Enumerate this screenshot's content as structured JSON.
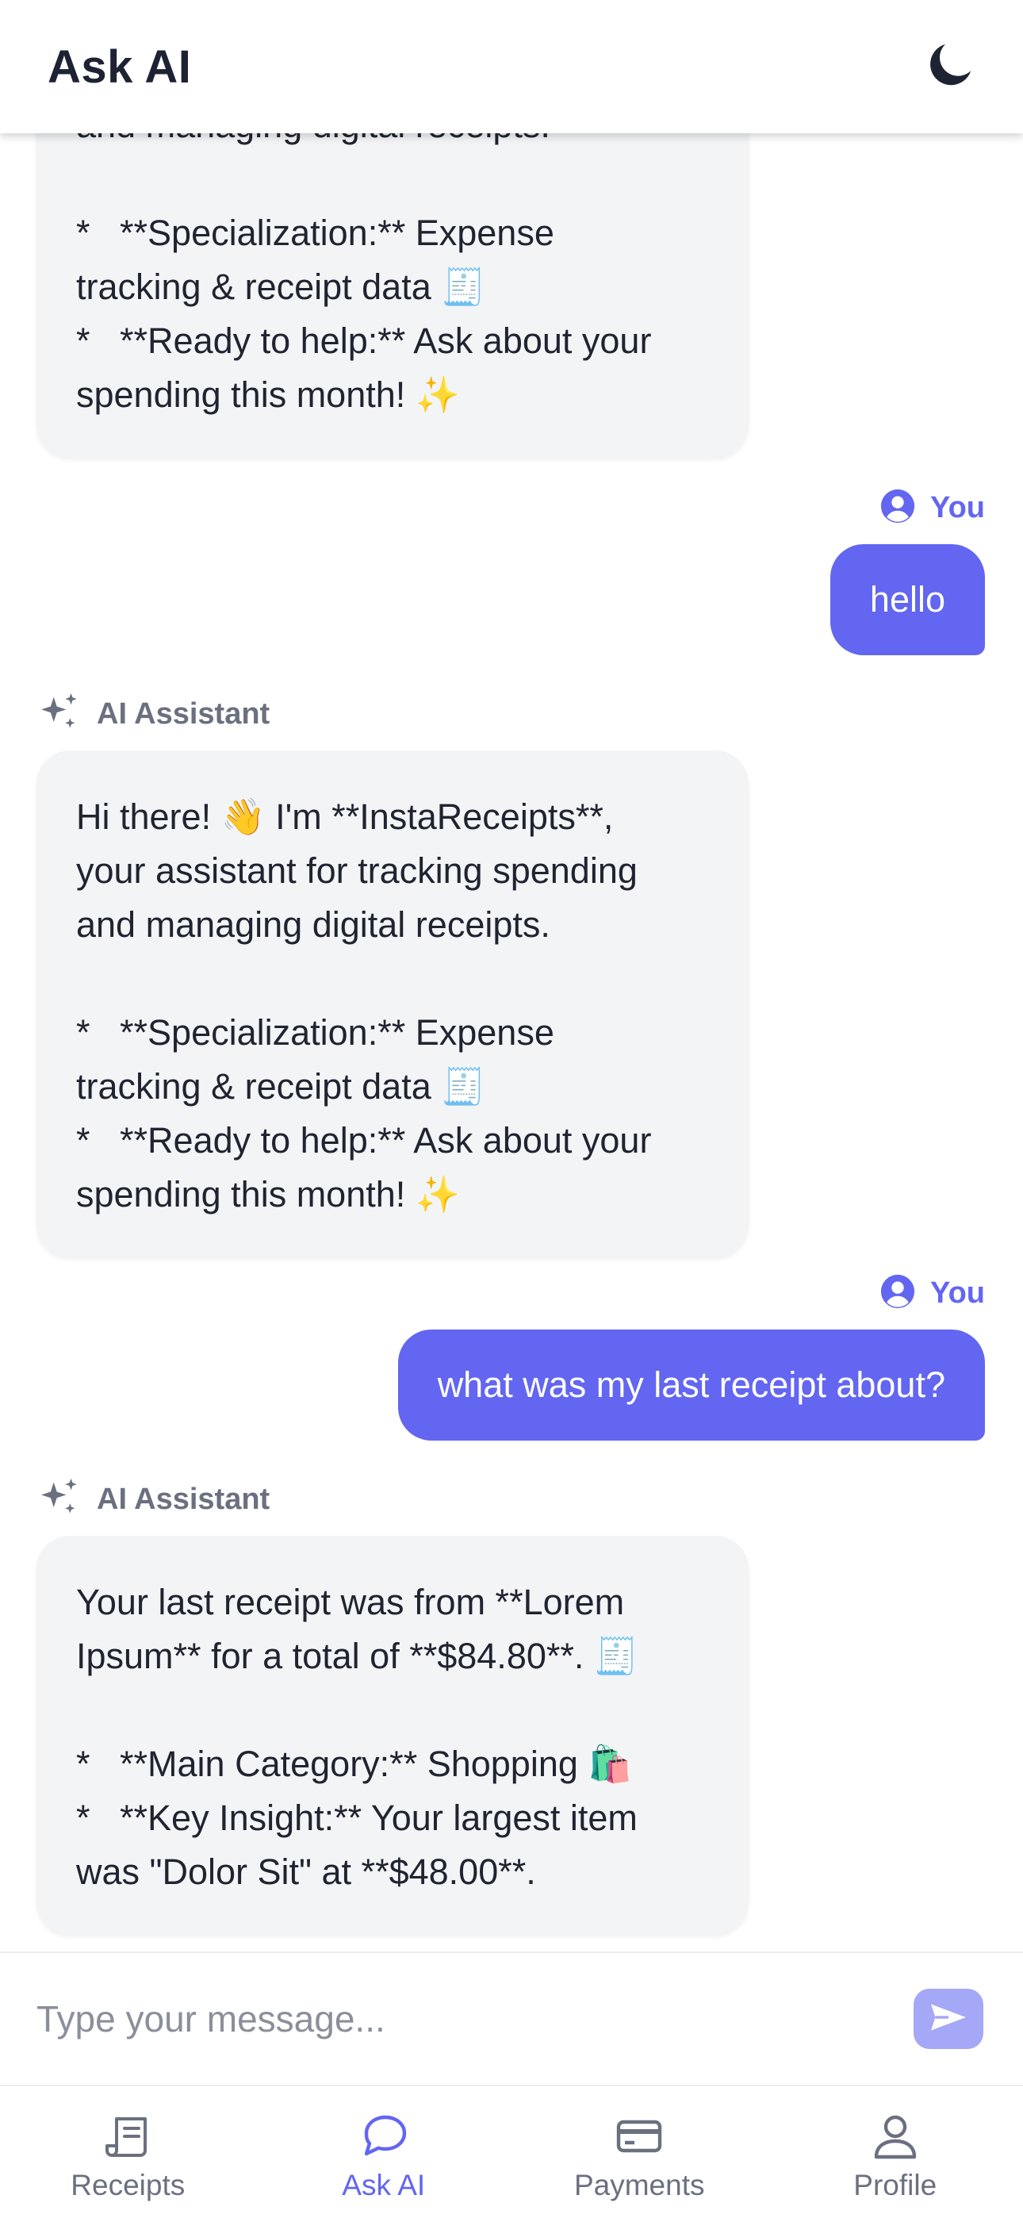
{
  "header": {
    "title": "Ask AI",
    "theme_icon": "moon-icon"
  },
  "colors": {
    "accent": "#6366f1",
    "ai_bubble": "#f3f4f6",
    "muted": "#6b7080",
    "send_button": "#a5a8f6"
  },
  "messages": [
    {
      "role": "ai",
      "lines": [
        "and managing digital receipts.",
        "",
        "*   **Specialization:** Expense",
        "tracking & receipt data 🧾",
        "*   **Ready to help:** Ask about your",
        "spending this month! ✨"
      ]
    },
    {
      "role": "user",
      "sender": "You",
      "text": "hello"
    },
    {
      "role": "ai",
      "sender": "AI Assistant",
      "lines": [
        "Hi there! 👋 I'm **InstaReceipts**,",
        "your assistant for tracking spending",
        "and managing digital receipts.",
        "",
        "*   **Specialization:** Expense",
        "tracking & receipt data 🧾",
        "*   **Ready to help:** Ask about your",
        "spending this month! ✨"
      ]
    },
    {
      "role": "user",
      "sender": "You",
      "text": "what was my last receipt about?"
    },
    {
      "role": "ai",
      "sender": "AI Assistant",
      "lines": [
        "Your last receipt was from **Lorem",
        "Ipsum** for a total of **$84.80**. 🧾",
        "",
        "*   **Main Category:** Shopping 🛍️",
        "*   **Key Insight:** Your largest item",
        "was \"Dolor Sit\" at **$48.00**."
      ]
    }
  ],
  "composer": {
    "placeholder": "Type your message..."
  },
  "nav": [
    {
      "label": "Receipts",
      "icon": "receipt-icon",
      "active": false
    },
    {
      "label": "Ask AI",
      "icon": "chat-bubble-icon",
      "active": true
    },
    {
      "label": "Payments",
      "icon": "credit-card-icon",
      "active": false
    },
    {
      "label": "Profile",
      "icon": "user-icon",
      "active": false
    }
  ]
}
